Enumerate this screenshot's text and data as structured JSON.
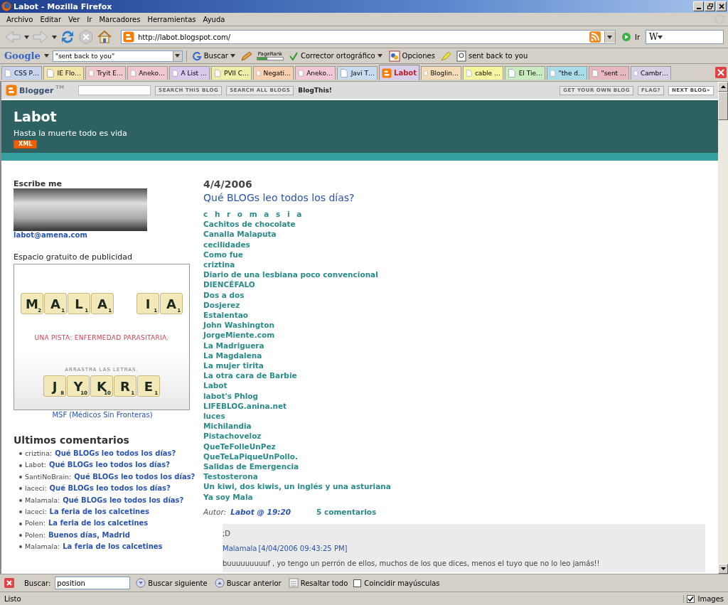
{
  "window": {
    "title": "Labot - Mozilla Firefox"
  },
  "menu": [
    "Archivo",
    "Editar",
    "Ver",
    "Ir",
    "Marcadores",
    "Herramientas",
    "Ayuda"
  ],
  "nav": {
    "url": "http://labot.blogspot.com/",
    "go_label": "Ir",
    "search_engine": "W"
  },
  "google_toolbar": {
    "logo": "Google",
    "query": "\"sent back to you\"",
    "search_label": "Buscar",
    "pagerank": {
      "label": "PageRank",
      "level": 0.4
    },
    "spell_label": "Corrector ortográfico",
    "options_label": "Opciones",
    "highlight_label": "sent back to you"
  },
  "tabs": [
    {
      "label": "CSS P…",
      "selected": false,
      "color": "#c8d4ee"
    },
    {
      "label": "IE Flo…",
      "selected": false,
      "color": "#f4e6a8"
    },
    {
      "label": "Tryit E…",
      "selected": false,
      "color": "#f2c8cc"
    },
    {
      "label": "Aneko…",
      "selected": false,
      "color": "#f2c8d0"
    },
    {
      "label": "A List …",
      "selected": false,
      "color": "#d8c8ec"
    },
    {
      "label": "PVII C…",
      "selected": false,
      "color": "#eef0a8"
    },
    {
      "label": "Negati…",
      "selected": false,
      "color": "#f8d0b0"
    },
    {
      "label": "Aneko…",
      "selected": false,
      "color": "#f2c8d8"
    },
    {
      "label": "Javi T…",
      "selected": false,
      "color": "#c8dcf0"
    },
    {
      "label": "Labot",
      "selected": true,
      "color": "#d8d0e8"
    },
    {
      "label": "Bloglin…",
      "selected": false,
      "color": "#f4dcb8"
    },
    {
      "label": "cable …",
      "selected": false,
      "color": "#f6f6a0"
    },
    {
      "label": "El Tie…",
      "selected": false,
      "color": "#c8ecc0"
    },
    {
      "label": "\"the d…",
      "selected": false,
      "color": "#a8dce8"
    },
    {
      "label": "\"sent …",
      "selected": false,
      "color": "#e8b8c0"
    },
    {
      "label": "Cambr…",
      "selected": false,
      "color": "#d8d0e4"
    }
  ],
  "blogger_bar": {
    "logo": "Blogger",
    "tm": "TM",
    "buttons": [
      "SEARCH THIS BLOG",
      "SEARCH ALL BLOGS"
    ],
    "blogthis": "BlogThis!",
    "right_buttons": [
      "GET YOUR OWN BLOG",
      "FLAG?",
      "NEXT BLOG»"
    ]
  },
  "header": {
    "title": "Labot",
    "tagline": "Hasta la muerte todo es vida",
    "feed_badge": "XML"
  },
  "sidebar": {
    "contact_heading": "Escribe me",
    "email": "labot@amena.com",
    "ad_heading": "Espacio gratuito de publicidad",
    "ad": {
      "top_tiles": [
        {
          "letter": "M",
          "points": "2"
        },
        {
          "letter": "A",
          "points": "1"
        },
        {
          "letter": "L",
          "points": "1"
        },
        {
          "letter": "A",
          "points": "1"
        },
        {
          "letter": "I",
          "points": "1"
        },
        {
          "letter": "A",
          "points": "1"
        }
      ],
      "hint": "UNA PISTA: ENFERMEDAD PARASITARIA.",
      "instruction": "ARRASTRA LAS LETRAS.",
      "bottom_tiles": [
        {
          "letter": "J",
          "points": "8"
        },
        {
          "letter": "Y",
          "points": "10"
        },
        {
          "letter": "K",
          "points": "10"
        },
        {
          "letter": "R",
          "points": "1"
        },
        {
          "letter": "E",
          "points": "1"
        }
      ]
    },
    "ad_caption": "MSF (Médicos Sin Fronteras)",
    "comments_heading": "Ultimos comentarios",
    "comments": [
      {
        "author": "criztina:",
        "post": "Qué BLOGs leo todos los días?"
      },
      {
        "author": "Labot:",
        "post": "Qué BLOGs leo todos los días?"
      },
      {
        "author": "SantiNoBrain:",
        "post": "Qué BLOGs leo todos los días?"
      },
      {
        "author": "laceci:",
        "post": "Qué BLOGs leo todos los días?"
      },
      {
        "author": "Malamala:",
        "post": "Qué BLOGs leo todos los días?"
      },
      {
        "author": "laceci:",
        "post": "La feria de los calcetines"
      },
      {
        "author": "Polen:",
        "post": "La feria de los calcetines"
      },
      {
        "author": "Polen:",
        "post": "Buenos días, Madrid"
      },
      {
        "author": "Malamala:",
        "post": "La feria de los calcetines"
      }
    ]
  },
  "post": {
    "date": "4/4/2006",
    "title": "Qué BLOGs leo todos los días?",
    "blogs": [
      "c h r o m a s i a",
      "Cachitos de chocolate",
      "Canalla Malaputa",
      "cecilidades",
      "Como fue",
      "criztina",
      "Diario de una lesbiana poco convencional",
      "DIENCÉFALO",
      "Dos a dos",
      "Dosjerez",
      "Estalentao",
      "John Washington",
      "JorgeMiente.com",
      "La Madriguera",
      "La Magdalena",
      "La mujer tirita",
      "La otra cara de Barbie",
      "Labot",
      "labot's Phlog",
      "LIFEBLOG.anina.net",
      "luces",
      "Michilandia",
      "Pistachoveloz",
      "QueTeFolleUnPez",
      "QueTeLaPiqueUnPollo.",
      "Salidas de Emergencia",
      "Testosterona",
      "Un kiwi, dos kiwis, un inglés y una asturiana",
      "Ya soy Mala"
    ],
    "byline_label": "Autor:",
    "byline_link": "Labot @ 19:20",
    "comments_link": "5 comentarios",
    "comment": {
      "previous_text": ";D",
      "author": "Malamala",
      "timestamp": "[4/04/2006 09:43:25 PM]",
      "text": "buuuuuuuuuf , yo tengo un perrón de ellos, muchos de los que dices, menos el tuyo que no lo leo jamás!!"
    }
  },
  "find_bar": {
    "label": "Buscar:",
    "value": "position",
    "next": "Buscar siguiente",
    "previous": "Buscar anterior",
    "highlight": "Resaltar todo",
    "match_case": {
      "label": "Coincidir mayúsculas",
      "checked": false
    }
  },
  "status_bar": {
    "text": "Listo",
    "images": {
      "label": "Images",
      "checked": true
    }
  }
}
